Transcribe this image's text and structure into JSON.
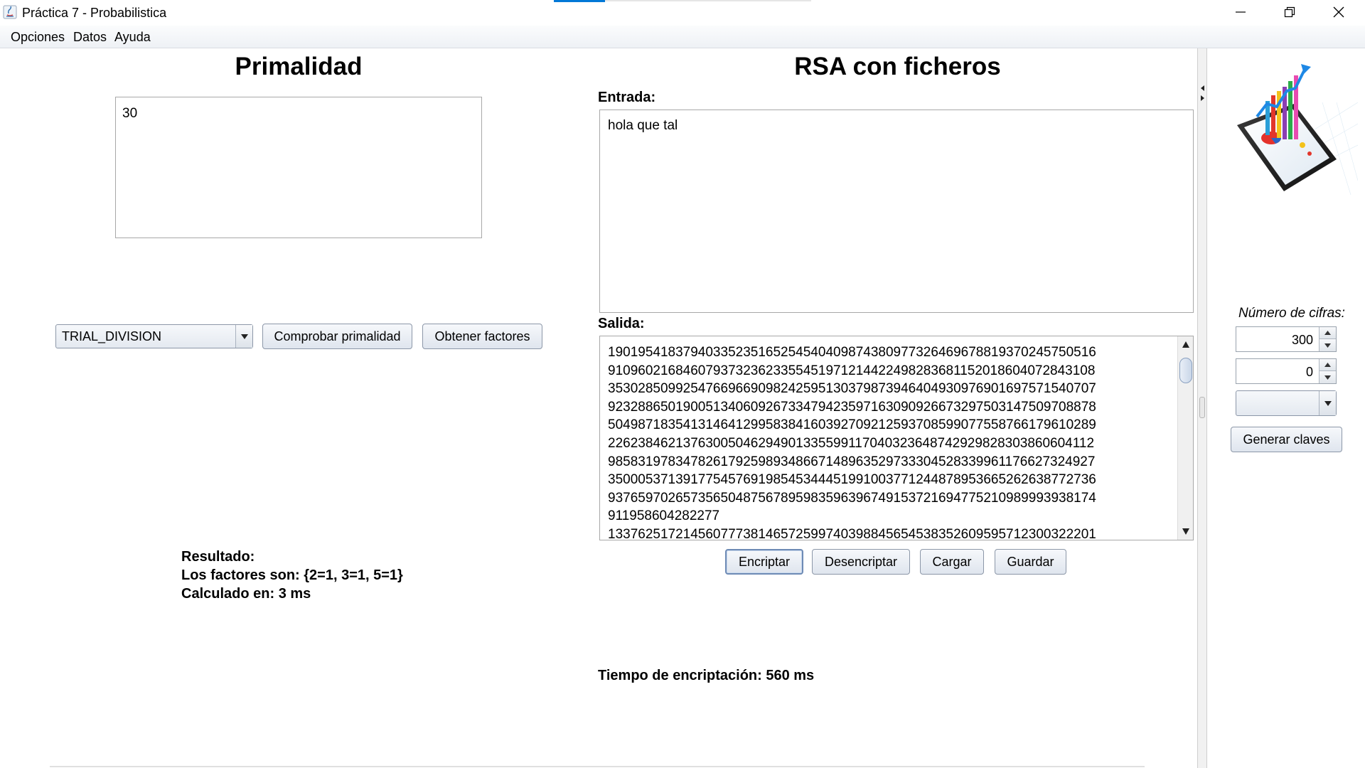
{
  "window": {
    "title": "Práctica 7 - Probabilistica",
    "minimize_icon": "minimize-icon",
    "maximize_icon": "restore-icon",
    "close_icon": "close-icon"
  },
  "menu": [
    "Opciones",
    "Datos",
    "Ayuda"
  ],
  "primalidad": {
    "title": "Primalidad",
    "input_value": "30",
    "algorithm": "TRIAL_DIVISION",
    "check_button": "Comprobar primalidad",
    "factors_button": "Obtener factores",
    "result_label": "Resultado:",
    "result_factors": "Los factores son: {2=1, 3=1, 5=1}",
    "result_time": "Calculado en: 3 ms"
  },
  "rsa": {
    "title": "RSA con ficheros",
    "input_label": "Entrada:",
    "input_value": "hola que tal",
    "output_label": "Salida:",
    "output_lines": [
      "19019541837940335235165254540409874380977326469678819370245750516",
      "91096021684607937323623355451971214422498283681152018604072843108",
      "35302850992547669669098242595130379873946404930976901697571540707",
      "92328865019005134060926733479423597163090926673297503147509708878",
      "50498718354131464129958384160392709212593708599077558766179610289",
      "22623846213763005046294901335599117040323648742929828303860604112",
      "98583197834782617925989348667148963529733304528339961176627324927",
      "35000537139177545769198545344451991003771244878953665262638772736",
      "93765970265735650487567895983596396749153721694775210989993938174",
      "911958604282277",
      "13376251721456077738146572599740398845654538352609595712300322201"
    ],
    "encrypt_button": "Encriptar",
    "decrypt_button": "Desencriptar",
    "load_button": "Cargar",
    "save_button": "Guardar",
    "time_text": "Tiempo de encriptación: 560 ms"
  },
  "keys": {
    "digits_label": "Número de cifras:",
    "digits_value": "300",
    "second_value": "0",
    "combo_value": "",
    "generate_button": "Generar claves",
    "logo_icon": "chart-tablet-icon"
  }
}
